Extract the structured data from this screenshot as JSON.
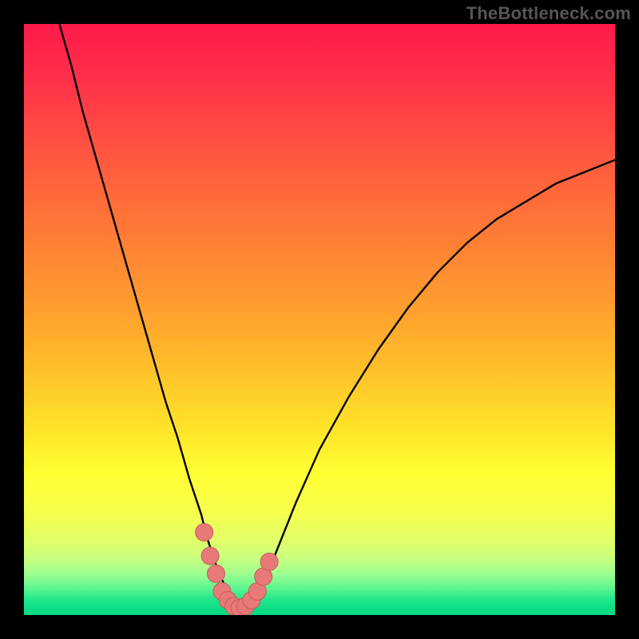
{
  "watermark": "TheBottleneck.com",
  "colors": {
    "frame": "#000000",
    "curve_stroke": "#000000",
    "marker_fill": "#e77a79",
    "marker_stroke": "#c85a59",
    "gradient_stops": [
      {
        "offset": 0.0,
        "color": "#ff1a4a"
      },
      {
        "offset": 0.1,
        "color": "#ff3249"
      },
      {
        "offset": 0.22,
        "color": "#ff5640"
      },
      {
        "offset": 0.35,
        "color": "#ff7a36"
      },
      {
        "offset": 0.48,
        "color": "#ff9e2e"
      },
      {
        "offset": 0.58,
        "color": "#ffbf2a"
      },
      {
        "offset": 0.68,
        "color": "#ffe22a"
      },
      {
        "offset": 0.76,
        "color": "#ffff33"
      },
      {
        "offset": 0.82,
        "color": "#f7ff4a"
      },
      {
        "offset": 0.87,
        "color": "#e4ff66"
      },
      {
        "offset": 0.905,
        "color": "#c8ff80"
      },
      {
        "offset": 0.93,
        "color": "#9eff90"
      },
      {
        "offset": 0.955,
        "color": "#5cf58f"
      },
      {
        "offset": 0.975,
        "color": "#1de789"
      },
      {
        "offset": 1.0,
        "color": "#00d884"
      }
    ]
  },
  "chart_data": {
    "type": "line",
    "title": "",
    "xlabel": "",
    "ylabel": "",
    "xlim": [
      0,
      100
    ],
    "ylim": [
      0,
      100
    ],
    "x": [
      6,
      8,
      10,
      12,
      14,
      16,
      18,
      20,
      22,
      24,
      26,
      28,
      30,
      31,
      32,
      33,
      34,
      35,
      36,
      37,
      38,
      39,
      40,
      41,
      42,
      44,
      46,
      50,
      55,
      60,
      65,
      70,
      75,
      80,
      85,
      90,
      95,
      100
    ],
    "y": [
      100,
      93,
      85,
      78,
      71,
      64,
      57,
      50,
      43,
      36,
      30,
      23,
      17,
      13,
      10,
      7,
      5,
      3,
      2,
      1,
      1,
      2,
      4,
      6,
      9,
      14,
      19,
      28,
      37,
      45,
      52,
      58,
      63,
      67,
      70,
      73,
      75,
      77
    ],
    "markers": {
      "x": [
        30.5,
        31.5,
        32.5,
        33.5,
        34.5,
        35.5,
        36.5,
        37.5,
        38.5,
        39.5,
        40.5,
        41.5
      ],
      "y": [
        14,
        10,
        7,
        4,
        2.5,
        1.5,
        1.2,
        1.5,
        2.5,
        4,
        6.5,
        9
      ]
    }
  }
}
